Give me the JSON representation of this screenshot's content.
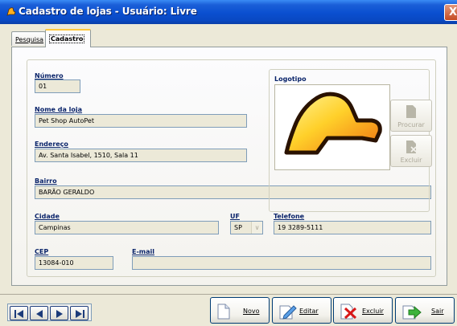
{
  "window": {
    "title": "Cadastro de lojas - Usuário: Livre",
    "close_label": "X"
  },
  "tabs": [
    {
      "label": "Pesquisa",
      "active": false
    },
    {
      "label": "Cadastro",
      "active": true
    }
  ],
  "form": {
    "numero_label": "Número",
    "numero_value": "01",
    "nome_label": "Nome da loja",
    "nome_value": "Pet Shop AutoPet",
    "endereco_label": "Endereço",
    "endereco_value": "Av. Santa Isabel, 1510, Sala 11",
    "bairro_label": "Bairro",
    "bairro_value": "BARÃO GERALDO",
    "cidade_label": "Cidade",
    "cidade_value": "Campinas",
    "uf_label": "UF",
    "uf_value": "SP",
    "telefone_label": "Telefone",
    "telefone_value": "19 3289-5111",
    "cep_label": "CEP",
    "cep_value": "13084-010",
    "email_label": "E-mail",
    "email_value": ""
  },
  "logo": {
    "label": "Logotipo",
    "procurar_label": "Procurar",
    "excluir_label": "Excluir"
  },
  "bottom": {
    "nav_icons": [
      "first-record-icon",
      "previous-record-icon",
      "next-record-icon",
      "last-record-icon"
    ],
    "novo_label": "Novo",
    "editar_label": "Editar",
    "excluir_label": "Excluir",
    "sair_label": "Sair"
  },
  "colors": {
    "titlebar": "#0a4fd0",
    "label_blue": "#0a246a",
    "field_bg": "#ece9d8",
    "field_border": "#7f9db9"
  }
}
